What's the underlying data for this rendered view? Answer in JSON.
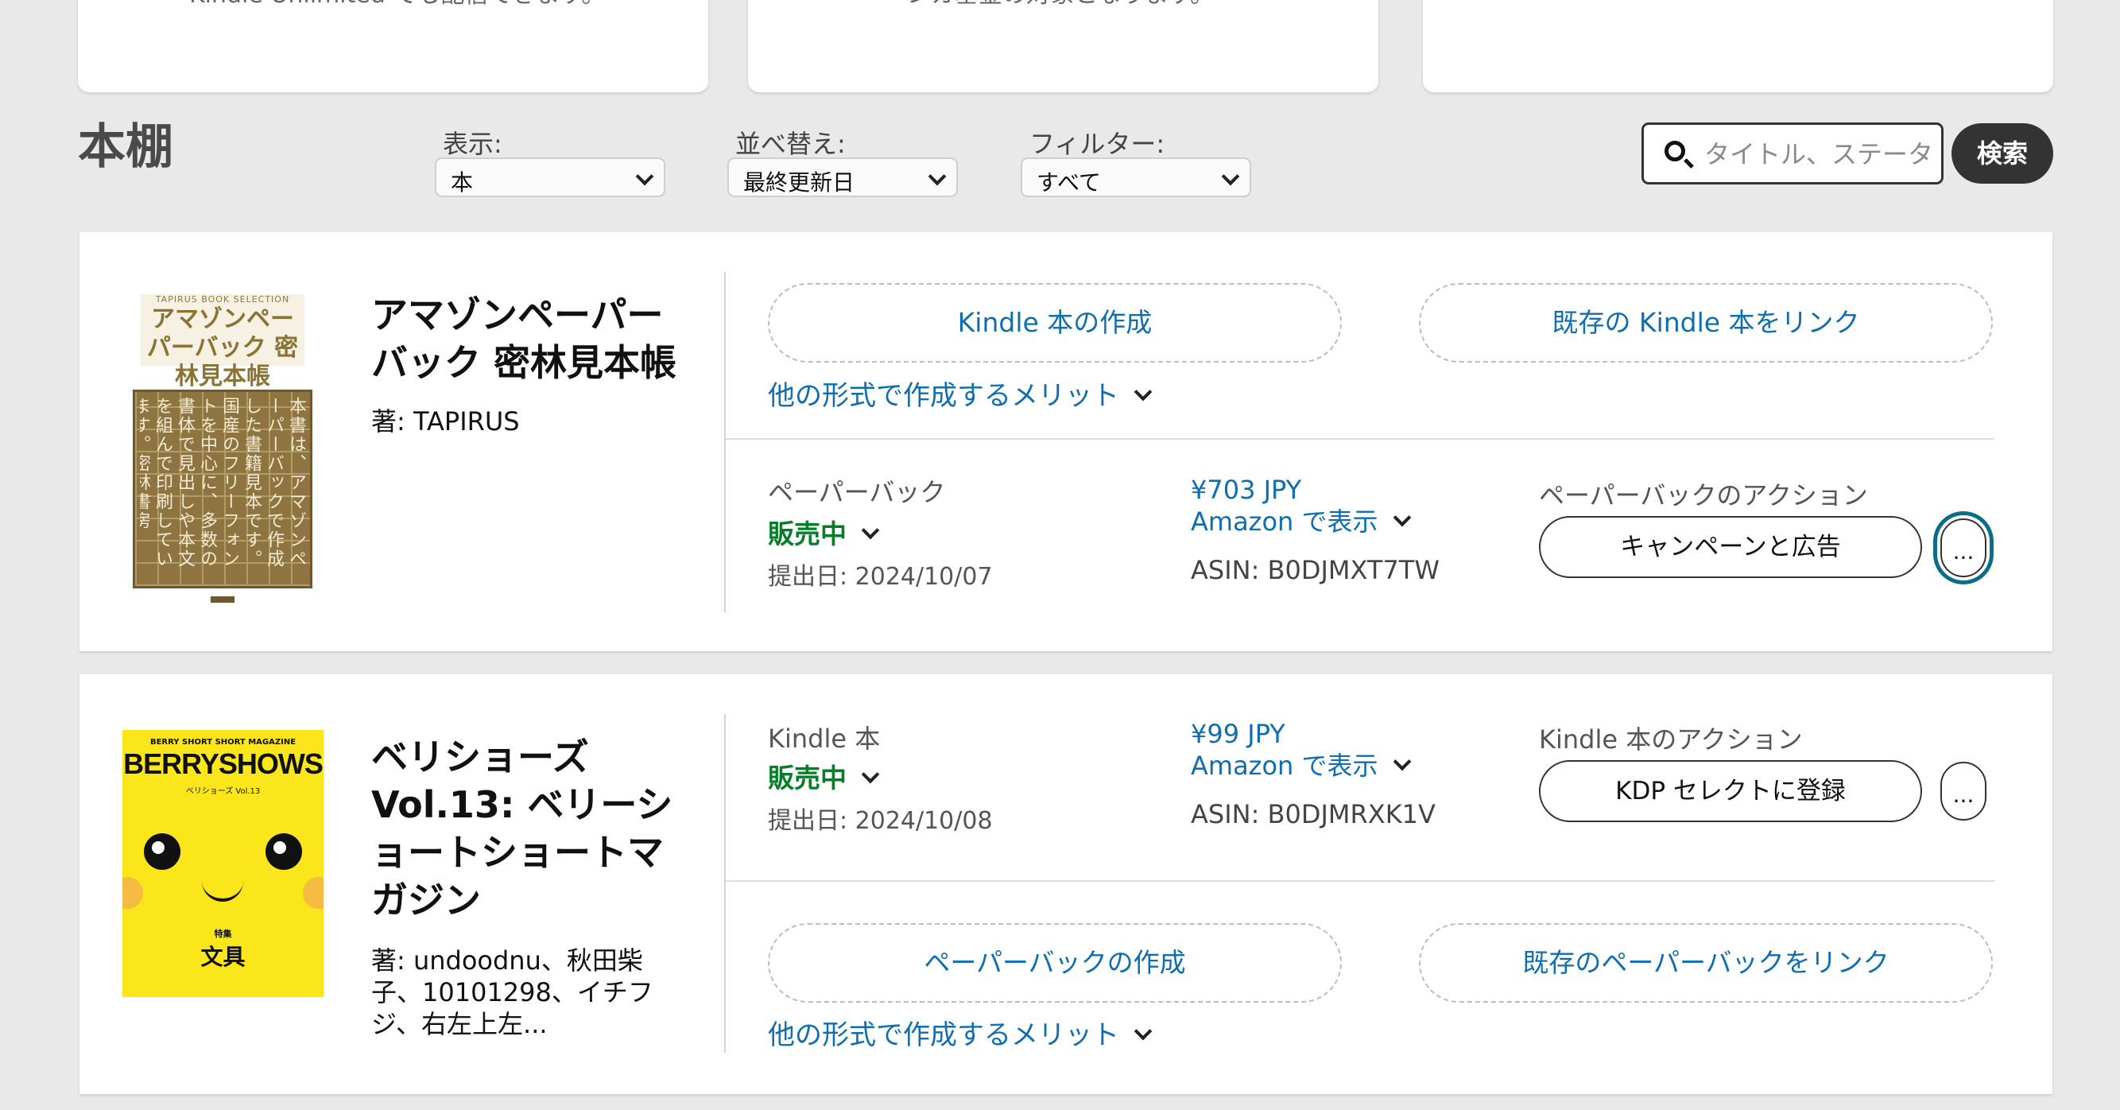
{
  "top_cards": {
    "card1_text": "Kindle Unlimited でも配信できます。",
    "card2_text": "ンカ基金の対象となります。"
  },
  "header": {
    "title": "本棚",
    "display_label": "表示:",
    "display_value": "本",
    "sort_label": "並べ替え:",
    "sort_value": "最終更新日",
    "filter_label": "フィルター:",
    "filter_value": "すべて",
    "search_placeholder": "タイトル、ステータスで検索",
    "search_button": "検索"
  },
  "books": [
    {
      "cover_small": "TAPIRUS BOOK SELECTION",
      "cover_big": "アマゾンペーパーバック 密林見本帳",
      "cover_body": "本書は、アマゾンペーパーバックで作成した書籍見本です。国産のフリーフォントを中心に、多数の書体で見出しや本文を組んで印刷しています。密林書房",
      "title": "アマゾンペーパーバック 密林見本帳",
      "author": "著: TAPIRUS",
      "actions_top": {
        "create_button": "Kindle 本の作成",
        "link_button": "既存の Kindle 本をリンク",
        "benefits_link": "他の形式で作成するメリット"
      },
      "format": {
        "type": "ペーパーバック",
        "status": "販売中",
        "submitted": "提出日: 2024/10/07",
        "price": "¥703 JPY",
        "view_on_amazon": "Amazon で表示",
        "asin": "ASIN: B0DJMXT7TW",
        "actions_label": "ペーパーバックのアクション",
        "primary_action": "キャンペーンと広告",
        "more": "..."
      }
    },
    {
      "cover_small": "BERRY SHORT SHORT MAGAZINE",
      "cover_big": "BERRYSHOWS",
      "cover_sub": "ベリショーズ Vol.13",
      "cover_feature": "特集",
      "cover_word": "文具",
      "title": "ベリショーズ Vol.13: ベリーショートショートマガジン",
      "author": "著: undoodnu、秋田柴子、10101298、イチフジ、右左上左...",
      "format": {
        "type": "Kindle 本",
        "status": "販売中",
        "submitted": "提出日: 2024/10/08",
        "price": "¥99 JPY",
        "view_on_amazon": "Amazon で表示",
        "asin": "ASIN: B0DJMRXK1V",
        "actions_label": "Kindle 本のアクション",
        "primary_action": "KDP セレクトに登録",
        "more": "..."
      },
      "actions_bottom": {
        "create_button": "ペーパーバックの作成",
        "link_button": "既存のペーパーバックをリンク",
        "benefits_link": "他の形式で作成するメリット"
      }
    }
  ],
  "colors": {
    "link": "#0f6eb0",
    "status_green": "#067d28",
    "focus_ring": "#0a6f86",
    "search_button_bg": "#333333"
  }
}
